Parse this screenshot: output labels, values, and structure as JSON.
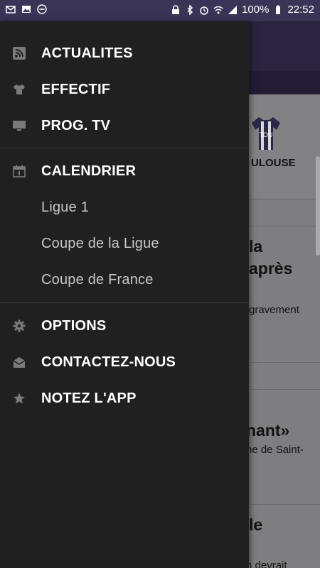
{
  "status_bar": {
    "battery_text": "100%",
    "time": "22:52"
  },
  "drawer": {
    "items": [
      {
        "label": "ACTUALITES"
      },
      {
        "label": "EFFECTIF"
      },
      {
        "label": "PROG. TV"
      },
      {
        "label": "CALENDRIER"
      },
      {
        "label": "Ligue 1"
      },
      {
        "label": "Coupe de la Ligue"
      },
      {
        "label": "Coupe de France"
      },
      {
        "label": "OPTIONS"
      },
      {
        "label": "CONTACTEZ-NOUS"
      },
      {
        "label": "NOTEZ L'APP"
      }
    ]
  },
  "background": {
    "team_name": "ULOUSE",
    "jersey_text": "TOU",
    "article1_line1": "la",
    "article1_line2": "après",
    "article1_snippet": "gravement",
    "article2_title": "nant»",
    "article2_snippet": "ne de Saint-",
    "article3_title": "le",
    "article3_snippet": "n devrait"
  },
  "colors": {
    "status_bar": "#3a3456",
    "drawer_bg": "#202020",
    "app_toolbar": "#2a2440"
  }
}
